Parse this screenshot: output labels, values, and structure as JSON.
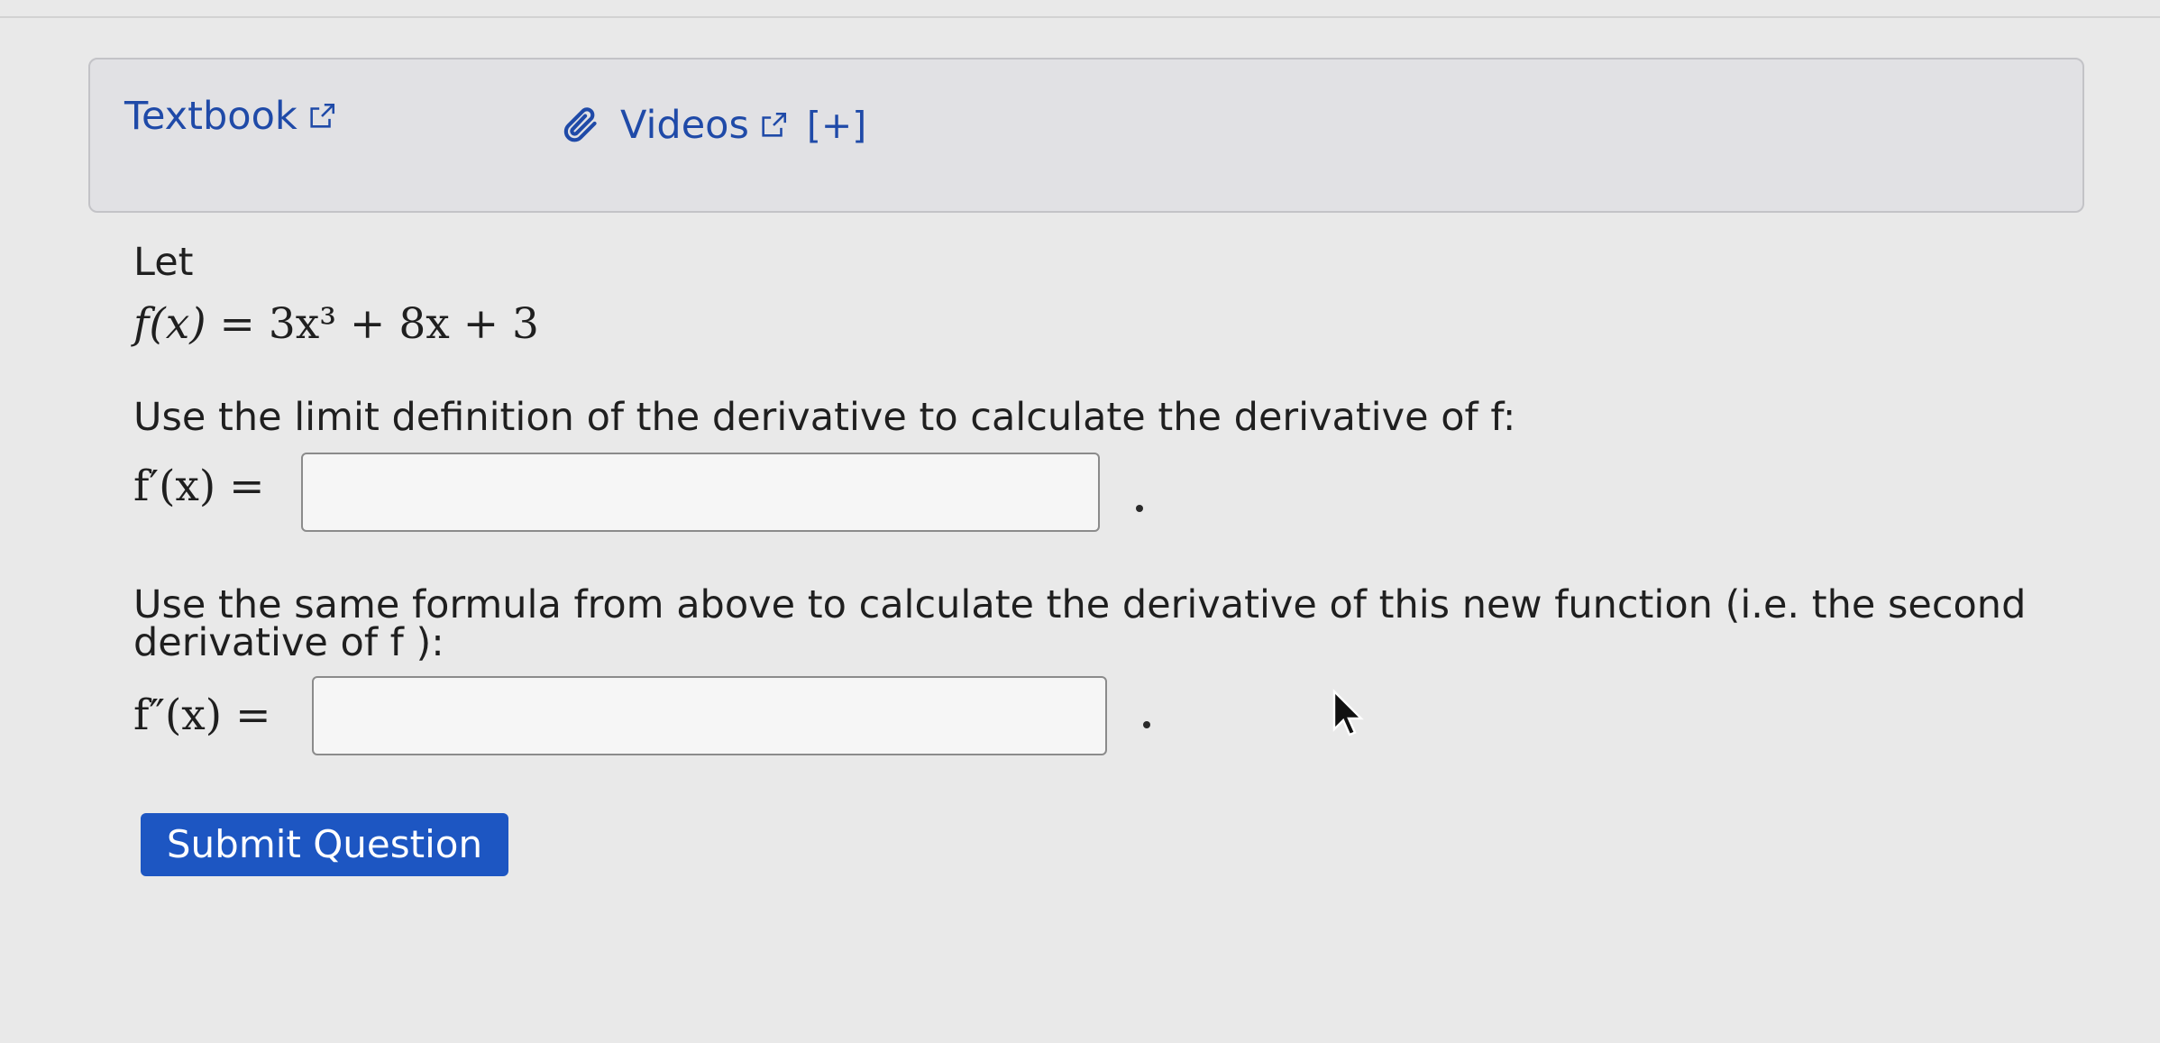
{
  "help_links": {
    "textbook": "Textbook",
    "videos": "Videos",
    "expand": "[+]"
  },
  "icons": {
    "external_link": "external-link-icon",
    "paperclip": "paperclip-icon",
    "mouse_pointer": "mouse-pointer-icon"
  },
  "problem": {
    "intro": "Let",
    "function_lhs": "f(x)",
    "function_rhs": "= 3x³ + 8x + 3",
    "question1": "Use the limit definition of the derivative to calculate the derivative of f:",
    "first_derivative_label": "f′(x) =",
    "answer1_value": "",
    "question2_line1": "Use the same formula from above to calculate the derivative of this new function (i.e. the second",
    "question2_line2": "derivative of f ):",
    "second_derivative_label": "f″(x) =",
    "answer2_value": "",
    "trailing_period": "."
  },
  "actions": {
    "submit_label": "Submit Question"
  },
  "colors": {
    "link": "#1f4aa8",
    "button": "#1d56c2",
    "background": "#e9e9e9",
    "help_box": "#e1e1e4"
  }
}
